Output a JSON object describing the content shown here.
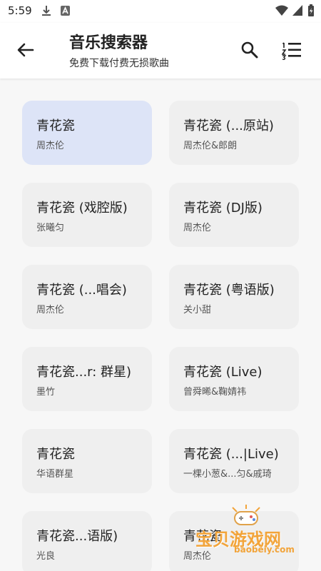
{
  "status": {
    "time": "5:59"
  },
  "header": {
    "title": "音乐搜索器",
    "subtitle": "免费下载付费无损歌曲"
  },
  "songs": [
    {
      "title": "青花瓷",
      "artist": "周杰伦",
      "selected": true
    },
    {
      "title": "青花瓷 (...原站)",
      "artist": "周杰伦&郎朗"
    },
    {
      "title": "青花瓷 (戏腔版)",
      "artist": "张曦匀"
    },
    {
      "title": "青花瓷 (DJ版)",
      "artist": "周杰伦"
    },
    {
      "title": "青花瓷 (...唱会)",
      "artist": "周杰伦"
    },
    {
      "title": "青花瓷 (粤语版)",
      "artist": "关小甜"
    },
    {
      "title": "青花瓷...r: 群星)",
      "artist": "墨竹"
    },
    {
      "title": "青花瓷 (Live)",
      "artist": "曾舜晞&鞠婧祎"
    },
    {
      "title": "青花瓷",
      "artist": "华语群星"
    },
    {
      "title": "青花瓷 (...|Live)",
      "artist": "一棵小葱&...匀&戚琦"
    },
    {
      "title": "青花瓷...语版)",
      "artist": "光良"
    },
    {
      "title": "青花瓷",
      "artist": "周杰伦"
    }
  ],
  "watermark": {
    "text": "宝贝游戏网",
    "url": "baobeiy.com"
  },
  "colors": {
    "selected_card": "#dde4f7",
    "card": "#efefef",
    "watermark": "#f2a43a"
  }
}
